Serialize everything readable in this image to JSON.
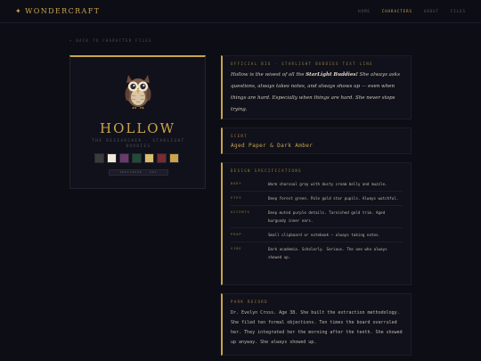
{
  "header": {
    "brand_star": "✦",
    "brand": "WONDERCRAFT",
    "nav": [
      "HOME",
      "CHARACTERS",
      "ABOUT",
      "FILES"
    ],
    "active_nav": "CHARACTERS"
  },
  "back_link": "← BACK TO CHARACTER FILES",
  "card": {
    "name": "HOLLOW",
    "subtitle": "THE RESEARCHER · STARLIGHT BUDDIES",
    "tag": "SPELLBOOK · OWL",
    "palette": [
      "#3a3a3a",
      "#f0ead6",
      "#6a3a6e",
      "#1f4d34",
      "#d9be6b",
      "#7a2a30",
      "#c9a44a"
    ]
  },
  "bio": {
    "label": "OFFICIAL BIO · STARLIGHT BUDDIES TEXT LINE",
    "prefix": "Hollow is the wisest of all the ",
    "emphasis": "StarLight Buddies!",
    "suffix": " She always asks questions, always takes notes, and always shows up — even when things are hard. Especially when things are hard. She never stops trying."
  },
  "scent": {
    "label": "SCENT",
    "value": "Aged Paper & Dark Amber"
  },
  "design": {
    "label": "DESIGN SPECIFICATIONS",
    "rows": [
      {
        "key": "BODY",
        "value": "Warm charcoal gray with dusty cream belly and muzzle."
      },
      {
        "key": "EYES",
        "value": "Deep forest green. Pale gold star pupils. Always watchful."
      },
      {
        "key": "ACCENTS",
        "value": "Deep muted purple details. Tarnished gold trim. Aged burgundy inner ears."
      },
      {
        "key": "PROP",
        "value": "Small clipboard or notebook — always taking notes."
      },
      {
        "key": "VIBE",
        "value": "Dark academia. Scholarly. Serious. The one who always showed up."
      }
    ]
  },
  "park": {
    "label": "PARK RECORD",
    "text": "Dr. Evelyn Cross. Age 38. She built the extraction methodology. She filed ten formal objections. Ten times the board overruled her. They integrated her the morning after the tenth. She showed up anyway. She always showed up."
  },
  "colors": {
    "accent": "#c9a44a",
    "background": "#0d0d15",
    "panel": "#11111b"
  },
  "icons": {
    "mascot": "owl-illustration"
  }
}
